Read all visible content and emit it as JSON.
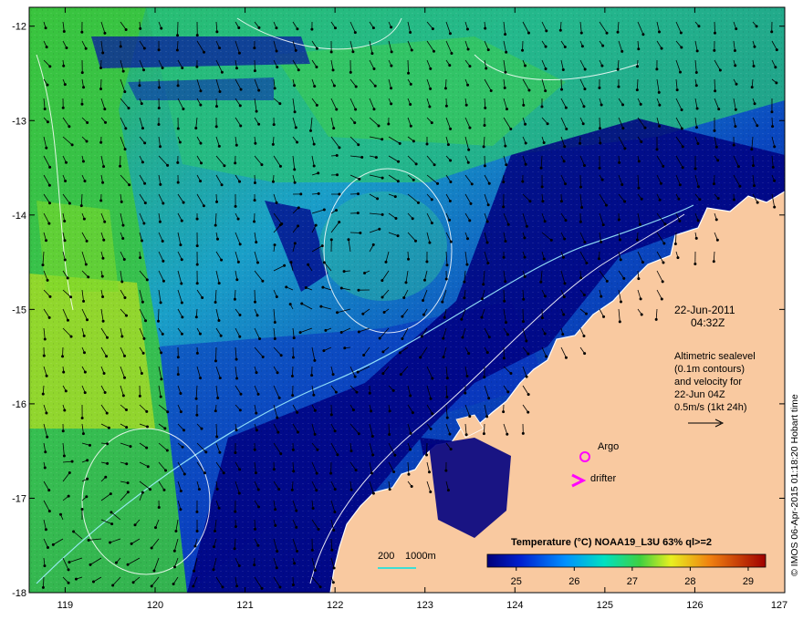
{
  "map": {
    "date": "22-Jun-2011",
    "time": "04:32Z",
    "altimetry_lines": [
      "Altimetric sealevel",
      "(0.1m contours)",
      "and velocity for",
      "22-Jun 04Z",
      "0.5m/s (1kt 24h)"
    ],
    "argo_label": "Argo",
    "drifter_label": "drifter",
    "depth_label_200": "200",
    "depth_label_1000": "1000m",
    "credit": "© IMOS 06-Apr-2015 01:18:20 Hobart time",
    "colorbar_title": "Temperature (°C) NOAA19_L3U 63% ql>=2",
    "colorbar_ticks": [
      "25",
      "26",
      "27",
      "28",
      "29"
    ],
    "lon_ticks": [
      "119",
      "120",
      "121",
      "122",
      "123",
      "124",
      "125",
      "126",
      "127"
    ],
    "lat_ticks": [
      "-12",
      "-13",
      "-14",
      "-15",
      "-16",
      "-17",
      "-18"
    ],
    "colors": {
      "land": "#f9c9a0",
      "cold": "#00007a",
      "mid": "#1a8cff",
      "warm": "#3ccc3c",
      "hot": "#f0f020",
      "argo_marker": "#ff00ff",
      "drifter_marker": "#ff00ff",
      "depth_contour_200": "#00e5e5"
    }
  }
}
